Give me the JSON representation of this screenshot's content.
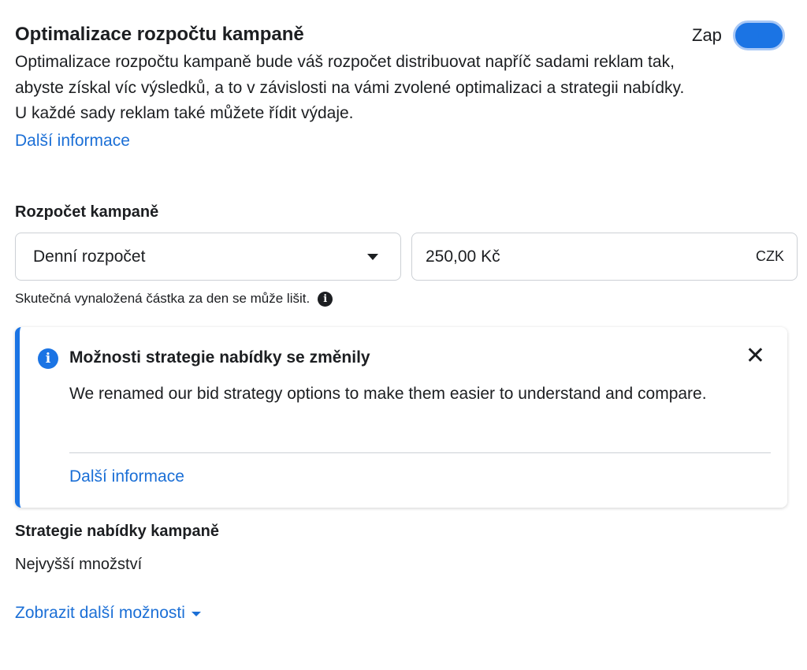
{
  "budget_optimization": {
    "title": "Optimalizace rozpočtu kampaně",
    "toggle_label": "Zap",
    "toggle_on": true,
    "description": "Optimalizace rozpočtu kampaně bude váš rozpočet distribuovat napříč sadami reklam tak, abyste získal víc výsledků, a to v závislosti na vámi zvolené optimalizaci a strategii nabídky. U každé sady reklam také můžete řídit výdaje.",
    "learn_more": "Další informace"
  },
  "campaign_budget": {
    "label": "Rozpočet kampaně",
    "budget_type": "Denní rozpočet",
    "amount": "250,00 Kč",
    "currency": "CZK",
    "hint": "Skutečná vynaložená částka za den se může lišit."
  },
  "notice": {
    "title": "Možnosti strategie nabídky se změnily",
    "body": "We renamed our bid strategy options to make them easier to understand and compare.",
    "learn_more": "Další informace"
  },
  "bid_strategy": {
    "label": "Strategie nabídky kampaně",
    "value": "Nejvyšší množství",
    "more_options": "Zobrazit další možnosti"
  },
  "colors": {
    "accent": "#1b74e4",
    "link": "#1b6fd6",
    "text": "#1c1e21",
    "border": "#ccd0d5"
  }
}
